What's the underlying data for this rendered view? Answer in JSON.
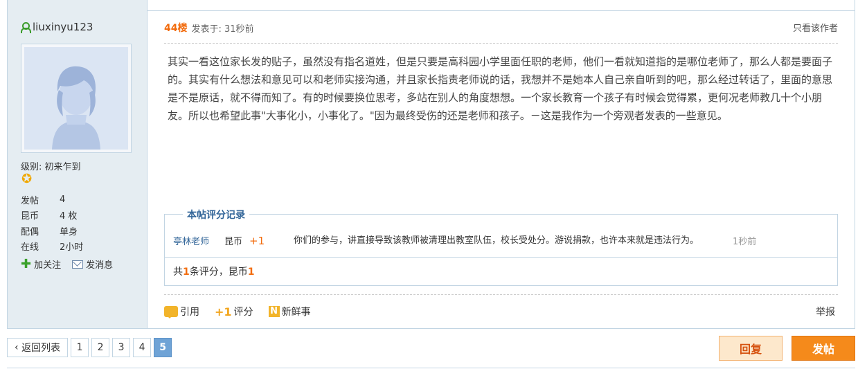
{
  "author": {
    "name": "liuxinyu123",
    "level_label": "级别: 初来乍到",
    "stats": [
      {
        "label": "发帖",
        "value": "4"
      },
      {
        "label": "昆币",
        "value": "4 枚"
      },
      {
        "label": "配偶",
        "value": "单身"
      },
      {
        "label": "在线",
        "value": "2小时"
      }
    ],
    "follow_label": "加关注",
    "message_label": "发消息"
  },
  "post": {
    "floor": "44楼",
    "posted_at": "发表于: 31秒前",
    "only_author": "只看该作者",
    "content": "其实一看这位家长发的贴子，虽然没有指名道姓，但是只要是高科园小学里面任职的老师，他们一看就知道指的是哪位老师了，那么人都是要面子的。其实有什么想法和意见可以和老师实接沟通，并且家长指责老师说的话，我想并不是她本人自己亲自听到的吧，那么经过转话了，里面的意思是不是原话，就不得而知了。有的时候要换位思考，多站在别人的角度想想。一个家长教育一个孩子有时候会觉得累，更何况老师教几十个小朋友。所以也希望此事\"大事化小，小事化了。\"因为最终受伤的还是老师和孩子。－这是我作为一个旁观者发表的一些意见。"
  },
  "rating": {
    "title": "本帖评分记录",
    "entries": [
      {
        "rater": "亭林老师",
        "unit": "昆币",
        "value": "+1",
        "reason": "你们的参与，讲直接导致该教师被清理出教室队伍，校长受处分。游说捐款，也许本来就是违法行为。",
        "time": "1秒前"
      }
    ],
    "summary_prefix": "共",
    "summary_count": "1",
    "summary_mid": "条评分，昆币",
    "summary_total": "1"
  },
  "actions": {
    "quote": "引用",
    "rate": "评分",
    "fresh": "新鲜事",
    "report": "举报"
  },
  "pager": {
    "back": "返回列表",
    "pages": [
      "1",
      "2",
      "3",
      "4"
    ],
    "current": "5"
  },
  "buttons": {
    "reply": "回复",
    "post": "发帖"
  }
}
